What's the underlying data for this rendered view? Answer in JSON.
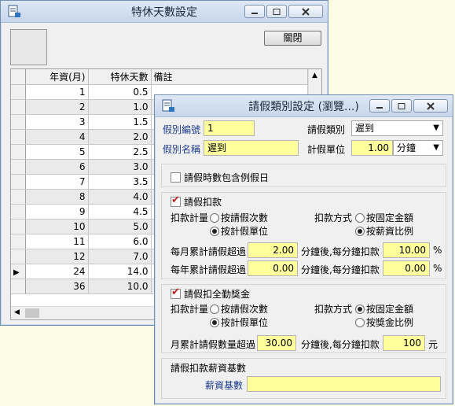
{
  "back_window": {
    "title": "特休天數設定",
    "close_label": "關閉",
    "columns": [
      "年資(月)",
      "特休天數",
      "備註"
    ],
    "rows": [
      {
        "months": "1",
        "days": "0.5"
      },
      {
        "months": "2",
        "days": "1.0"
      },
      {
        "months": "3",
        "days": "1.5"
      },
      {
        "months": "4",
        "days": "2.0"
      },
      {
        "months": "5",
        "days": "2.5"
      },
      {
        "months": "6",
        "days": "3.0"
      },
      {
        "months": "7",
        "days": "3.5"
      },
      {
        "months": "8",
        "days": "4.0"
      },
      {
        "months": "9",
        "days": "4.5"
      },
      {
        "months": "10",
        "days": "5.0"
      },
      {
        "months": "11",
        "days": "6.0"
      },
      {
        "months": "12",
        "days": "7.0"
      },
      {
        "months": "24",
        "days": "14.0"
      },
      {
        "months": "36",
        "days": "10.0"
      }
    ]
  },
  "front_window": {
    "title": "請假類別設定 (瀏覽...)",
    "leave_code_label": "假別編號",
    "leave_code_value": "1",
    "leave_type_label": "請假類別",
    "leave_type_value": "遲到",
    "leave_name_label": "假別名稱",
    "leave_name_value": "遲到",
    "unit_label": "計假單位",
    "unit_value": "1.00",
    "unit_select": "分鐘",
    "include_holiday_label": "請假時數包含例假日",
    "deduct": {
      "title": "請假扣款",
      "calc_label": "扣款計量",
      "opt_count": "按請假次數",
      "opt_unit": "按計假單位",
      "method_label": "扣款方式",
      "opt_fixed": "按固定金額",
      "opt_ratio": "按薪資比例",
      "monthly_label": "每月累計請假超過",
      "monthly_value": "2.00",
      "monthly_mid": "分鐘後,每分鐘扣款",
      "monthly_amount": "10.00",
      "yearly_label": "每年累計請假超過",
      "yearly_value": "0.00",
      "yearly_mid": "分鐘後,每分鐘扣款",
      "yearly_amount": "0.00",
      "pct": "%"
    },
    "bonus": {
      "title": "請假扣全勤獎金",
      "calc_label": "扣款計量",
      "opt_count": "按請假次數",
      "opt_unit": "按計假單位",
      "method_label": "扣款方式",
      "opt_fixed": "按固定金額",
      "opt_ratio": "按獎金比例",
      "monthly_label": "月累計請假數量超過",
      "monthly_value": "30.00",
      "monthly_mid": "分鐘後,每分鐘扣款",
      "monthly_amount": "100",
      "unit": "元"
    },
    "salary_base": {
      "title": "請假扣款薪資基數",
      "field_label": "薪資基數",
      "field_value": ""
    }
  }
}
